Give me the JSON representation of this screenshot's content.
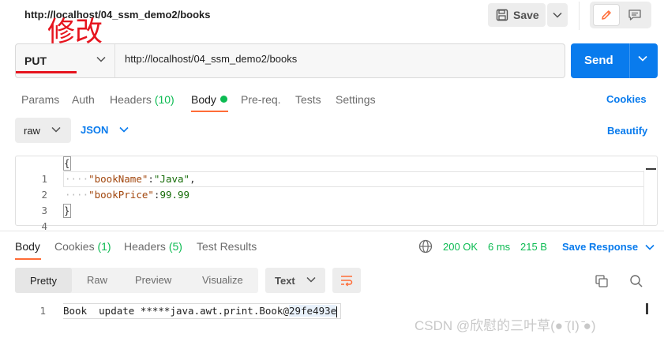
{
  "header": {
    "request_url": "http://localhost/04_ssm_demo2/books",
    "save_label": "Save"
  },
  "annotation": {
    "text": "修改",
    "color": "#e6141e"
  },
  "request": {
    "method": "PUT",
    "url": "http://localhost/04_ssm_demo2/books",
    "send_label": "Send"
  },
  "request_tabs": {
    "params": "Params",
    "auth": "Auth",
    "headers": "Headers",
    "headers_count": "(10)",
    "body": "Body",
    "prereq": "Pre-req.",
    "tests": "Tests",
    "settings": "Settings",
    "cookies": "Cookies"
  },
  "body_options": {
    "mode": "raw",
    "language": "JSON",
    "beautify": "Beautify"
  },
  "editor": {
    "line_numbers": [
      "1",
      "2",
      "3",
      "4"
    ],
    "open_brace": "{",
    "close_brace": "}",
    "indent": "····",
    "key1": "\"bookName\"",
    "colon": ":",
    "val1": "\"Java\"",
    "comma": ",",
    "key2": "\"bookPrice\"",
    "val2": "99.99"
  },
  "response_tabs": {
    "body": "Body",
    "cookies": "Cookies",
    "cookies_count": "(1)",
    "headers": "Headers",
    "headers_count": "(5)",
    "test_results": "Test Results"
  },
  "response_meta": {
    "status": "200 OK",
    "time": "6 ms",
    "size": "215 B",
    "save_response": "Save Response"
  },
  "response_view": {
    "pretty": "Pretty",
    "raw": "Raw",
    "preview": "Preview",
    "visualize": "Visualize",
    "format": "Text"
  },
  "response_body": {
    "line_number": "1",
    "text_prefix": "Book  update *****java.awt.print.Book@",
    "text_highlight": "29fe493e"
  },
  "watermark": "CSDN @欣慰的三叶草(● ̄(I) ̄●)",
  "colors": {
    "accent_orange": "#ff6c37",
    "brand_blue": "#097bed",
    "success_green": "#0cbb52"
  }
}
